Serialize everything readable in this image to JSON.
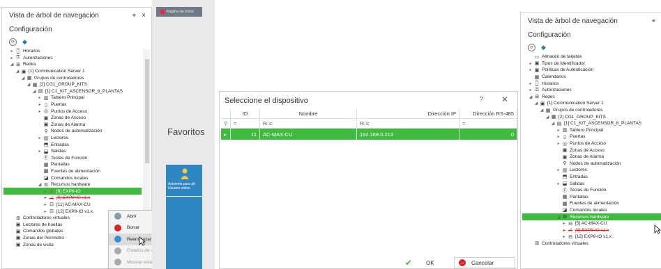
{
  "left_panel": {
    "title": "Vista de árbol de navegación",
    "pin": "⌖",
    "close": "×",
    "config": "Configuración",
    "tree": [
      {
        "label": "Horarios",
        "icon": "⌚",
        "indent": 1,
        "ar": "▸"
      },
      {
        "label": "Autorizaciones",
        "icon": "⚿",
        "indent": 1,
        "ar": "▸"
      },
      {
        "label": "Redes",
        "icon": "⊞",
        "indent": 1,
        "ar": "◢"
      },
      {
        "label": "[1] Communication Server 1",
        "icon": "▣",
        "indent": 2,
        "ar": "◢"
      },
      {
        "label": "Grupos de controladores",
        "icon": "▦",
        "indent": 3,
        "ar": "◢"
      },
      {
        "label": "[2] CG1_GROUP_KITS",
        "icon": "▦",
        "indent": 4,
        "ar": "◢"
      },
      {
        "label": "[1] C1_KIT_ASCENSOR_8_PLANTAS",
        "icon": "▤",
        "indent": 5,
        "ar": "◢"
      },
      {
        "label": "Tablero Principal",
        "icon": "▥",
        "indent": 6,
        "ar": "▸"
      },
      {
        "label": "Puertas",
        "icon": "▯",
        "indent": 6,
        "ar": "▸"
      },
      {
        "label": "Puntos de Acceso",
        "icon": "◎",
        "indent": 6,
        "ar": "▸"
      },
      {
        "label": "Zonas de Acceso",
        "icon": "▣",
        "indent": 6,
        "ar": ""
      },
      {
        "label": "Zonas de Alarma",
        "icon": "▣",
        "indent": 6,
        "ar": ""
      },
      {
        "label": "Nodos de automatización",
        "icon": "⚲",
        "indent": 6,
        "ar": ""
      },
      {
        "label": "Lectores",
        "icon": "▥",
        "indent": 6,
        "ar": "▸"
      },
      {
        "label": "Entradas",
        "icon": "⬒",
        "indent": 6,
        "ar": ""
      },
      {
        "label": "Salidas",
        "icon": "⬓",
        "indent": 6,
        "ar": "▸"
      },
      {
        "label": "Teclas de Función",
        "icon": "Ⓕ",
        "indent": 6,
        "ar": ""
      },
      {
        "label": "Pantallas",
        "icon": "▦",
        "indent": 6,
        "ar": ""
      },
      {
        "label": "Fuentes de alimentación",
        "icon": "▩",
        "indent": 6,
        "ar": ""
      },
      {
        "label": "Comandos locales",
        "icon": "◪",
        "indent": 6,
        "ar": ""
      },
      {
        "label": "Recursos hardware",
        "icon": "⚙",
        "indent": 6,
        "ar": "◢"
      },
      {
        "label": "[6] EXP8-IO",
        "icon": "⚠",
        "indent": 7,
        "ar": "▸",
        "style": "sel"
      },
      {
        "label": "[6] EXP8-IO v1.x",
        "icon": "⚠",
        "indent": 7,
        "ar": "▸",
        "style": "red"
      },
      {
        "label": "[11] AC-MAX-CU",
        "icon": "⊟",
        "indent": 7,
        "ar": "▸"
      },
      {
        "label": "[12] EXP8-IO v1.x",
        "icon": "⊟",
        "indent": 7,
        "ar": "▸"
      },
      {
        "label": "Controladores virtuales",
        "icon": "⊞",
        "indent": 1,
        "ar": ""
      },
      {
        "label": "Lectores de huellas",
        "icon": "▣",
        "indent": 1,
        "ar": ""
      },
      {
        "label": "Comandos globales",
        "icon": "▣",
        "indent": 1,
        "ar": ""
      },
      {
        "label": "Zonas del Perímetro",
        "icon": "▣",
        "indent": 1,
        "ar": ""
      },
      {
        "label": "Zonas de visita",
        "icon": "▣",
        "indent": 1,
        "ar": ""
      }
    ]
  },
  "context_menu": {
    "items": [
      {
        "label": "Abrir",
        "color": "#8a9bb0",
        "state": "normal"
      },
      {
        "label": "Borrar",
        "color": "#d22",
        "state": "normal"
      },
      {
        "label": "Reemplazar",
        "color": "#3a8fd6",
        "state": "hl"
      },
      {
        "label": "Estados de entrada",
        "color": "#aaa",
        "state": "dis"
      },
      {
        "label": "Mostrar estado del dispositivo",
        "color": "#aaa",
        "state": "dis"
      }
    ]
  },
  "middle": {
    "tab_label": "Página de inicio",
    "favoritos": "Favoritos",
    "tile_text": "Asistente para añ Usuario online"
  },
  "dialog": {
    "title": "Seleccione el dispositivo",
    "help": "?",
    "close": "✕",
    "columns": [
      "ID",
      "Nombre",
      "Dirección IP",
      "Dirección RS-485"
    ],
    "filter": [
      "=",
      "R□c",
      "R□c",
      "="
    ],
    "row": {
      "id": "11",
      "name": "AC-MAX-CU",
      "ip": "192.168.0.213",
      "rs485": "0"
    },
    "ok": "OK",
    "cancel": "Cancelar"
  },
  "right_panel": {
    "title": "Vista de árbol de navegación",
    "config": "Configuración",
    "tree": [
      {
        "label": "Almacén de tarjetas",
        "icon": "▭",
        "indent": 1,
        "ar": ""
      },
      {
        "label": "Tipos de Identificador",
        "icon": "▣",
        "indent": 1,
        "ar": "▸"
      },
      {
        "label": "Políticas de Autenticación",
        "icon": "▣",
        "indent": 1,
        "ar": "▸"
      },
      {
        "label": "Calendarios",
        "icon": "▦",
        "indent": 1,
        "ar": ""
      },
      {
        "label": "Horarios",
        "icon": "⌚",
        "indent": 1,
        "ar": "▸"
      },
      {
        "label": "Autorizaciones",
        "icon": "⚿",
        "indent": 1,
        "ar": "▸"
      },
      {
        "label": "Redes",
        "icon": "⊞",
        "indent": 1,
        "ar": "◢"
      },
      {
        "label": "[1] Communication Server 1",
        "icon": "▣",
        "indent": 2,
        "ar": "◢"
      },
      {
        "label": "Grupos de controladores",
        "icon": "▦",
        "indent": 3,
        "ar": "◢"
      },
      {
        "label": "[2] CG1_GROUP_KITS",
        "icon": "▦",
        "indent": 4,
        "ar": "◢"
      },
      {
        "label": "[1] C1_KIT_ASCENSOR_8_PLANTAS",
        "icon": "▤",
        "indent": 5,
        "ar": "◢"
      },
      {
        "label": "Tablero Principal",
        "icon": "▥",
        "indent": 6,
        "ar": "▸"
      },
      {
        "label": "Puertas",
        "icon": "▯",
        "indent": 6,
        "ar": "▸"
      },
      {
        "label": "Puntos de Acceso",
        "icon": "◎",
        "indent": 6,
        "ar": "▸"
      },
      {
        "label": "Zonas de Acceso",
        "icon": "▣",
        "indent": 6,
        "ar": ""
      },
      {
        "label": "Zonas de Alarma",
        "icon": "▣",
        "indent": 6,
        "ar": ""
      },
      {
        "label": "Nodos de automatización",
        "icon": "⚲",
        "indent": 6,
        "ar": ""
      },
      {
        "label": "Lectores",
        "icon": "▥",
        "indent": 6,
        "ar": "▸"
      },
      {
        "label": "Entradas",
        "icon": "⬒",
        "indent": 6,
        "ar": ""
      },
      {
        "label": "Salidas",
        "icon": "⬓",
        "indent": 6,
        "ar": "▸"
      },
      {
        "label": "Teclas de Función",
        "icon": "Ⓕ",
        "indent": 6,
        "ar": ""
      },
      {
        "label": "Pantallas",
        "icon": "▦",
        "indent": 6,
        "ar": ""
      },
      {
        "label": "Fuentes de alimentación",
        "icon": "▩",
        "indent": 6,
        "ar": ""
      },
      {
        "label": "Comandos locales",
        "icon": "◪",
        "indent": 6,
        "ar": ""
      },
      {
        "label": "Recursos hardware",
        "icon": "⚙",
        "indent": 6,
        "ar": "◢",
        "style": "sel"
      },
      {
        "label": "[5] AC-MAX-CU",
        "icon": "⊟",
        "indent": 7,
        "ar": "▸"
      },
      {
        "label": "[6] EXP8-IO v1.x",
        "icon": "⚠",
        "indent": 7,
        "ar": "▸",
        "style": "red"
      },
      {
        "label": "[12] EXP8-IO v1.x",
        "icon": "⊟",
        "indent": 7,
        "ar": "▸"
      },
      {
        "label": "Controladores virtuales",
        "icon": "⊞",
        "indent": 1,
        "ar": ""
      }
    ]
  }
}
